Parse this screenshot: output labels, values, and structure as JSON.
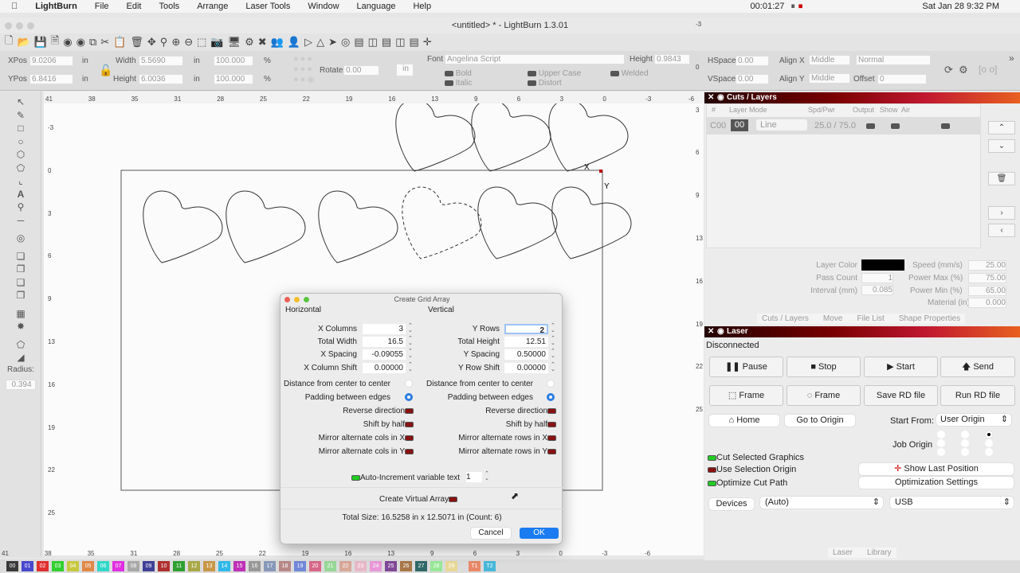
{
  "menubar": {
    "app": "LightBurn",
    "items": [
      "File",
      "Edit",
      "Tools",
      "Arrange",
      "Laser Tools",
      "Window",
      "Language",
      "Help"
    ],
    "clock": "00:01:27",
    "date": "Sat Jan 28  9:32 PM"
  },
  "window": {
    "title": "<untitled> * - LightBurn 1.3.01"
  },
  "props": {
    "xpos_label": "XPos",
    "xpos": "9.0206",
    "ypos_label": "YPos",
    "ypos": "6.8416",
    "unit": "in",
    "width_label": "Width",
    "width": "5.5690",
    "height_label": "Height",
    "height": "6.0036",
    "scale_w": "100.000",
    "scale_h": "100.000",
    "pct": "%",
    "rotate_label": "Rotate",
    "rotate": "0.00",
    "in_btn": "in",
    "font_label": "Font",
    "font": "Angelina Script",
    "fheight_label": "Height",
    "fheight": "0.9843",
    "bold": "Bold",
    "italic": "Italic",
    "upper": "Upper Case",
    "distort": "Distort",
    "welded": "Welded",
    "hspace_label": "HSpace",
    "hspace": "0.00",
    "vspace_label": "VSpace",
    "vspace": "0.00",
    "alignx_label": "Align X",
    "alignx": "Middle",
    "aligny_label": "Align Y",
    "aligny": "Middle",
    "mode": "Normal",
    "offset_label": "Offset",
    "offset": "0"
  },
  "left": {
    "radius_label": "Radius:",
    "radius": "0.394"
  },
  "ruler": {
    "top": [
      "41",
      "38",
      "35",
      "31",
      "28",
      "25",
      "22",
      "19",
      "16",
      "13",
      "9",
      "6",
      "3",
      "0",
      "-3",
      "-6"
    ],
    "left": [
      "-3",
      "0",
      "3",
      "6",
      "9",
      "13",
      "16",
      "19",
      "22",
      "25"
    ]
  },
  "canvas": {
    "x_label": "X",
    "y_label": "Y"
  },
  "cuts": {
    "title": "Cuts / Layers",
    "cols": [
      "#",
      "Layer",
      "Mode",
      "Spd/Pwr",
      "Output",
      "Show",
      "Air"
    ],
    "row": {
      "id": "C00",
      "layer": "00",
      "mode": "Line",
      "spdpwr": "25.0 / 75.0"
    },
    "layer_color_label": "Layer Color",
    "layer_color": "#000000",
    "pass_label": "Pass Count",
    "pass": "1",
    "interval_label": "Interval (mm)",
    "interval": "0.085",
    "speed_label": "Speed (mm/s)",
    "speed": "25.00",
    "pmax_label": "Power Max (%)",
    "pmax": "75.00",
    "pmin_label": "Power Min (%)",
    "pmin": "65.00",
    "material_label": "Material (in)",
    "material": "0.000",
    "tabs": [
      "Cuts / Layers",
      "Move",
      "File List",
      "Shape Properties"
    ]
  },
  "laser": {
    "title": "Laser",
    "status": "Disconnected",
    "buttons": [
      "Pause",
      "Stop",
      "Start",
      "Send",
      "Frame",
      "Frame",
      "Save RD file",
      "Run RD file"
    ],
    "home": "Home",
    "goto": "Go to Origin",
    "start_from_label": "Start From:",
    "start_from": "User Origin",
    "job_origin_label": "Job Origin",
    "cut_selected": "Cut Selected Graphics",
    "use_sel_origin": "Use Selection Origin",
    "optimize": "Optimize Cut Path",
    "show_last": "Show Last Position",
    "opt_settings": "Optimization Settings",
    "devices": "Devices",
    "device": "(Auto)",
    "port": "USB",
    "tabs": [
      "Laser",
      "Library"
    ]
  },
  "dialog": {
    "title": "Create Grid Array",
    "horizontal": "Horizontal",
    "vertical": "Vertical",
    "h_fields": [
      {
        "label": "X Columns",
        "value": "3"
      },
      {
        "label": "Total Width",
        "value": "16.5"
      },
      {
        "label": "X Spacing",
        "value": "-0.09055"
      },
      {
        "label": "X Column Shift",
        "value": "0.00000"
      }
    ],
    "v_fields": [
      {
        "label": "Y Rows",
        "value": "2"
      },
      {
        "label": "Total Height",
        "value": "12.51"
      },
      {
        "label": "Y Spacing",
        "value": "0.50000"
      },
      {
        "label": "Y Row Shift",
        "value": "0.00000"
      }
    ],
    "center": "Distance from center to center",
    "padding": "Padding between edges",
    "h_opts": [
      "Reverse direction",
      "Shift by half",
      "Mirror alternate cols in X",
      "Mirror alternate cols in Y"
    ],
    "v_opts": [
      "Reverse direction",
      "Shift by half",
      "Mirror alternate rows in X",
      "Mirror alternate rows in Y"
    ],
    "auto_inc": "Auto-Increment variable text",
    "auto_inc_value": "1",
    "virtual": "Create Virtual Array",
    "total": "Total Size: 16.5258 in x 12.5071 in  (Count: 6)",
    "cancel": "Cancel",
    "ok": "OK"
  },
  "palette": [
    {
      "l": "00",
      "c": "#3a3a3a"
    },
    {
      "l": "01",
      "c": "#4848d0"
    },
    {
      "l": "02",
      "c": "#e03030"
    },
    {
      "l": "03",
      "c": "#30d030"
    },
    {
      "l": "04",
      "c": "#c8c840"
    },
    {
      "l": "05",
      "c": "#e08848"
    },
    {
      "l": "06",
      "c": "#30d8c8"
    },
    {
      "l": "07",
      "c": "#e030e0"
    },
    {
      "l": "08",
      "c": "#a8a8a8"
    },
    {
      "l": "09",
      "c": "#404098"
    },
    {
      "l": "10",
      "c": "#b03030"
    },
    {
      "l": "11",
      "c": "#30a030"
    },
    {
      "l": "12",
      "c": "#a8a848"
    },
    {
      "l": "13",
      "c": "#c89848"
    },
    {
      "l": "14",
      "c": "#30b8e8"
    },
    {
      "l": "15",
      "c": "#c030b8"
    },
    {
      "l": "16",
      "c": "#989898"
    },
    {
      "l": "17",
      "c": "#8898b8"
    },
    {
      "l": "18",
      "c": "#b88888"
    },
    {
      "l": "19",
      "c": "#7088d8"
    },
    {
      "l": "20",
      "c": "#d86888"
    },
    {
      "l": "21",
      "c": "#98d898"
    },
    {
      "l": "22",
      "c": "#d8a898"
    },
    {
      "l": "23",
      "c": "#e8b8c8"
    },
    {
      "l": "24",
      "c": "#e898d8"
    },
    {
      "l": "25",
      "c": "#804898"
    },
    {
      "l": "26",
      "c": "#a87848"
    },
    {
      "l": "27",
      "c": "#306868"
    },
    {
      "l": "28",
      "c": "#98e898"
    },
    {
      "l": "29",
      "c": "#e8d898"
    },
    {
      "l": "T1",
      "c": "#e88868"
    },
    {
      "l": "T2",
      "c": "#48b8d8"
    }
  ]
}
